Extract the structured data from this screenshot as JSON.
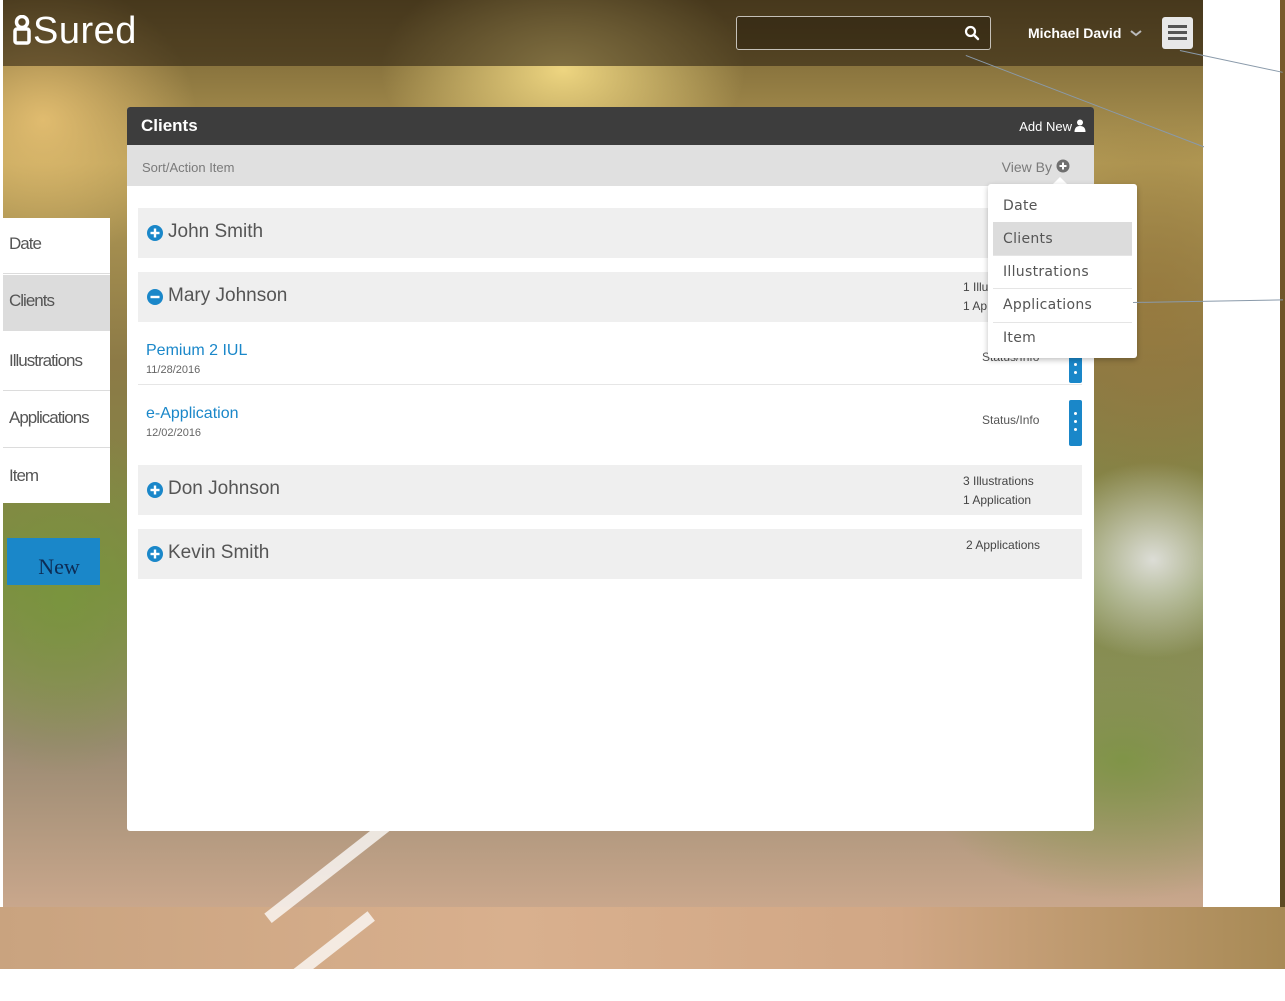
{
  "app": {
    "logo_text": "Sured",
    "search": {
      "placeholder": "",
      "value": ""
    },
    "user_name": "Michael David"
  },
  "clients_panel": {
    "title": "Clients",
    "add_new_label": "Add New",
    "sort_label": "Sort/Action Item",
    "view_by_label": "View By"
  },
  "view_by_menu": {
    "items": [
      "Date",
      "Clients",
      "Illustrations",
      "Applications",
      "Item"
    ],
    "selected": "Clients"
  },
  "clients": [
    {
      "name": "John Smith",
      "expanded": false,
      "meta": []
    },
    {
      "name": "Mary Johnson",
      "expanded": true,
      "meta": [
        "1 Illu",
        "1 Ap"
      ]
    },
    {
      "name": "Don Johnson",
      "expanded": false,
      "meta": [
        "3 Illustrations",
        "1 Application"
      ]
    },
    {
      "name": "Kevin Smith",
      "expanded": false,
      "meta": [
        "2 Applications"
      ]
    }
  ],
  "mary_items": [
    {
      "title": "Pemium 2 IUL",
      "date": "11/28/2016",
      "status": "Status/Info"
    },
    {
      "title": "e-Application",
      "date": "12/02/2016",
      "status": "Status/Info"
    }
  ],
  "left_panel": {
    "items": [
      "Date",
      "Clients",
      "Illustrations",
      "Applications",
      "Item"
    ],
    "selected": "Clients",
    "new_button_label": "New"
  },
  "colors": {
    "accent": "#1a87c9",
    "header_dark": "#3d3d3d",
    "row_bg": "#efefef",
    "selected_bg": "#dcdcdc"
  }
}
